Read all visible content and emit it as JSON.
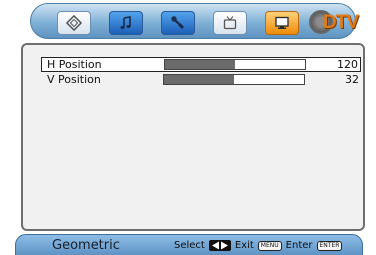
{
  "topbar": {
    "tabs": [
      {
        "icon": "film-icon",
        "style": "light"
      },
      {
        "icon": "music-note-icon",
        "style": "blue"
      },
      {
        "icon": "wrench-icon",
        "style": "blue"
      },
      {
        "icon": "tv-icon",
        "style": "light"
      },
      {
        "icon": "monitor-icon",
        "style": "orange"
      }
    ],
    "badge_text": "DTV"
  },
  "menu": {
    "items": [
      {
        "label": "H Position",
        "value": "120",
        "level": 0.5
      },
      {
        "label": "V Position",
        "value": "32",
        "level": 0.5
      }
    ]
  },
  "footer": {
    "title": "Geometric",
    "select_label": "Select",
    "exit_label": "Exit",
    "exit_key": "MENU",
    "enter_label": "Enter",
    "enter_key": "ENTER"
  },
  "colors": {
    "bar_fill": "#6b6b6b",
    "accent_orange": "#e07a18",
    "bar_blue": "#7fb0d6"
  }
}
